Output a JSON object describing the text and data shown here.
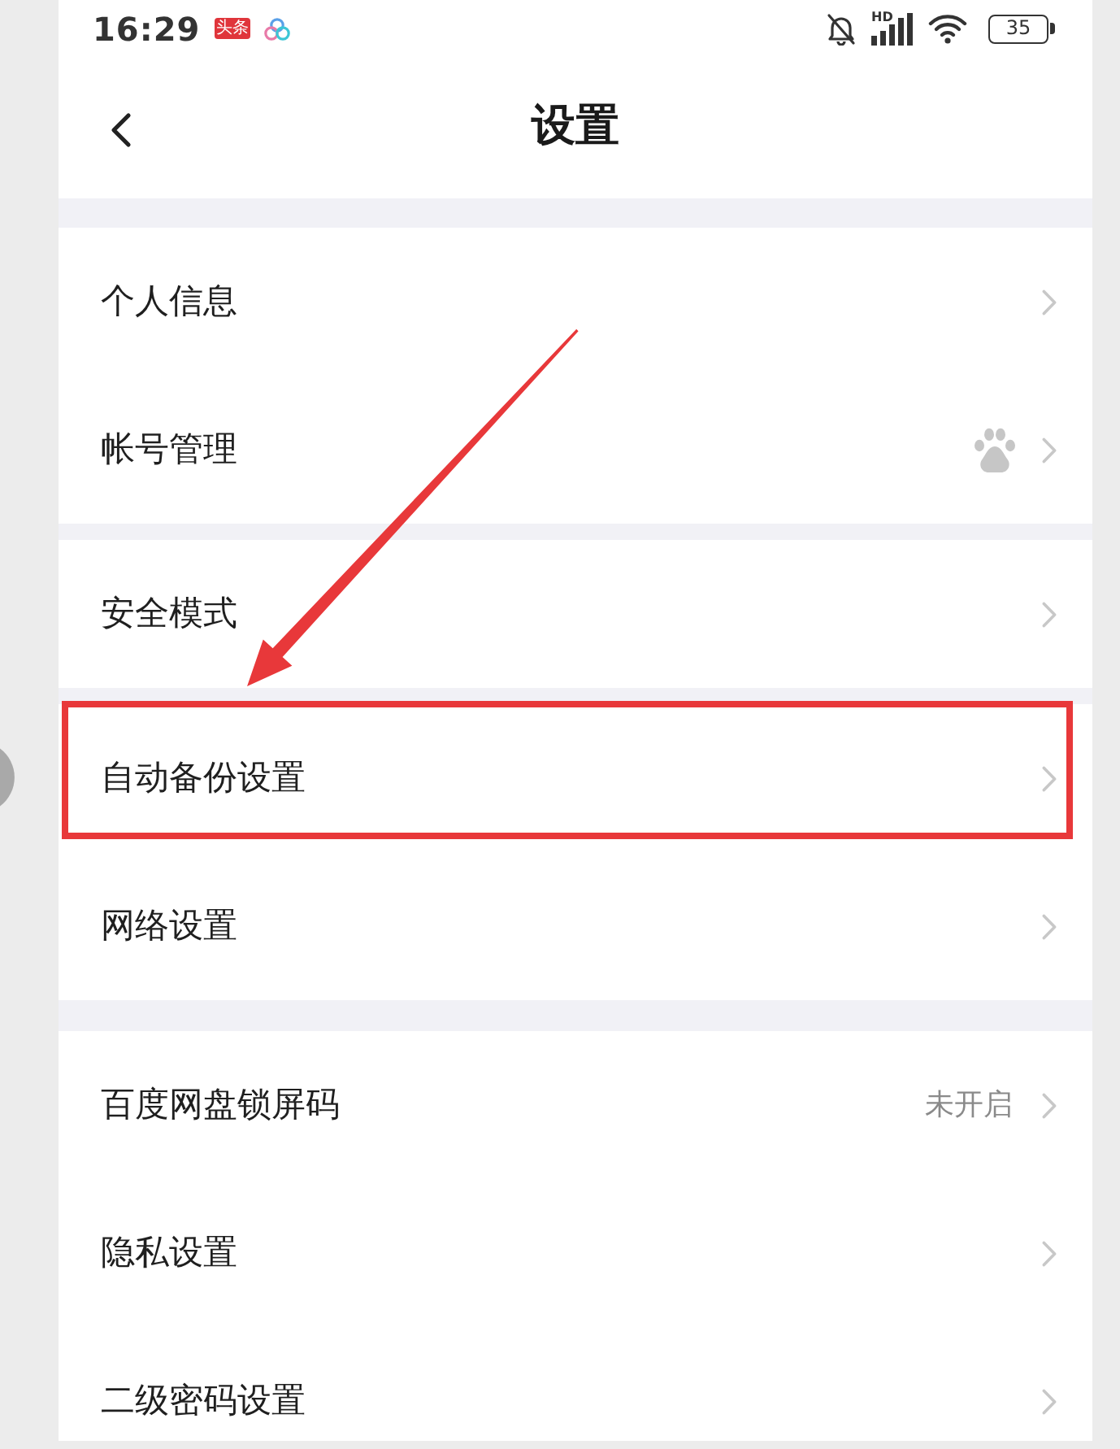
{
  "status_bar": {
    "time": "16:29",
    "app_tag": "头条",
    "network_label": "HD",
    "battery": "35"
  },
  "header": {
    "title": "设置"
  },
  "groups": [
    {
      "items": [
        {
          "label": "个人信息",
          "kind": "plain",
          "highlighted": false
        },
        {
          "label": "帐号管理",
          "kind": "icon",
          "highlighted": false
        }
      ]
    },
    {
      "items": [
        {
          "label": "安全模式",
          "kind": "plain",
          "highlighted": false
        }
      ]
    },
    {
      "items": [
        {
          "label": "自动备份设置",
          "kind": "plain",
          "highlighted": true
        },
        {
          "label": "网络设置",
          "kind": "plain",
          "highlighted": false
        }
      ]
    },
    {
      "items": [
        {
          "label": "百度网盘锁屏码",
          "kind": "value",
          "value": "未开启",
          "highlighted": false
        },
        {
          "label": "隐私设置",
          "kind": "plain",
          "highlighted": false
        },
        {
          "label": "二级密码设置",
          "kind": "plain",
          "highlighted": false
        }
      ]
    }
  ]
}
